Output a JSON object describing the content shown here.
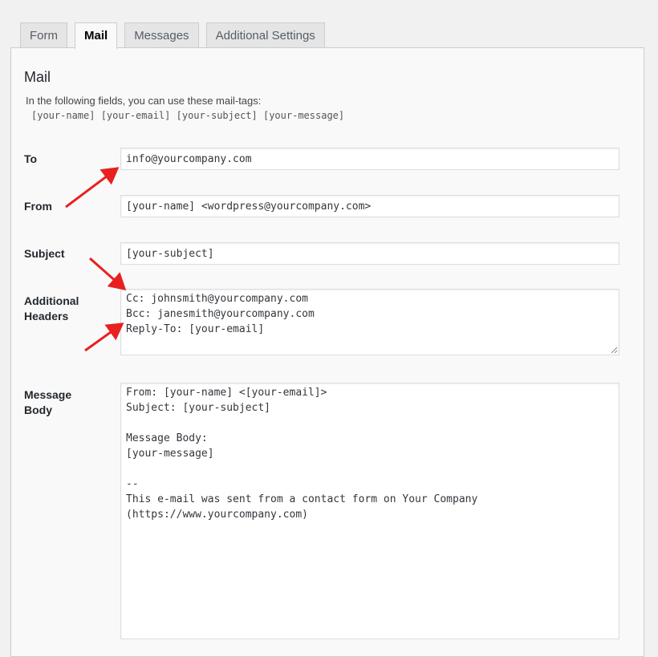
{
  "tabs": [
    {
      "label": "Form",
      "active": false
    },
    {
      "label": "Mail",
      "active": true
    },
    {
      "label": "Messages",
      "active": false
    },
    {
      "label": "Additional Settings",
      "active": false
    }
  ],
  "mail": {
    "heading": "Mail",
    "intro": "In the following fields, you can use these mail-tags:",
    "mail_tags": "[your-name] [your-email] [your-subject] [your-message]",
    "fields": {
      "to": {
        "label": "To",
        "value": "info@yourcompany.com"
      },
      "from": {
        "label": "From",
        "value": "[your-name] <wordpress@yourcompany.com>"
      },
      "subject": {
        "label": "Subject",
        "value": "[your-subject]"
      },
      "additional_headers": {
        "label_line1": "Additional",
        "label_line2": "Headers",
        "value": "Cc: johnsmith@yourcompany.com\nBcc: janesmith@yourcompany.com\nReply-To: [your-email]"
      },
      "message_body": {
        "label_line1": "Message",
        "label_line2": "Body",
        "value": "From: [your-name] <[your-email]>\nSubject: [your-subject]\n\nMessage Body:\n[your-message]\n\n--\nThis e-mail was sent from a contact form on Your Company\n(https://www.yourcompany.com)"
      }
    }
  },
  "annotation_color": "#e8201f"
}
